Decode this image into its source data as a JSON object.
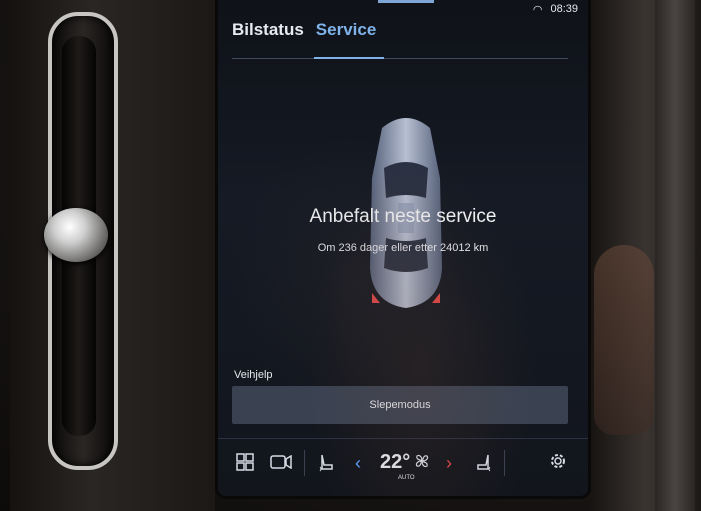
{
  "status_bar": {
    "time": "08:39"
  },
  "tabs": [
    {
      "label": "Bilstatus"
    },
    {
      "label": "Service"
    }
  ],
  "service": {
    "headline": "Anbefalt neste service",
    "detail": "Om 236 dager eller etter 24012 km"
  },
  "roadside": {
    "section_label": "Veihjelp",
    "tow_mode_button": "Slepemodus"
  },
  "climate": {
    "temperature": "22°",
    "mode": "AUTO"
  },
  "icons": [
    "apps-grid-icon",
    "camera-icon",
    "seat-heat-left-icon",
    "chevron-left-icon",
    "fan-icon",
    "chevron-right-icon",
    "seat-heat-right-icon",
    "gear-icon"
  ],
  "colors": {
    "accent": "#7fb2e8",
    "button_bg": "#3a4252",
    "red_arrow": "#e04848"
  }
}
